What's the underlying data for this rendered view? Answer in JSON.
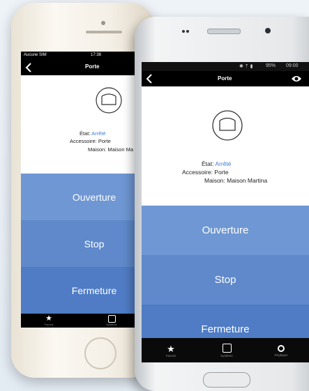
{
  "colors": {
    "link": "#3b7dd8",
    "btn_top": "#6f97d3",
    "btn_mid": "#5f89cb",
    "btn_bot": "#4f7cc4"
  },
  "iphone": {
    "status": {
      "carrier": "Aucune SIM",
      "time": "17:38"
    },
    "nav_title": "Porte",
    "info": {
      "etat_label": "État:",
      "etat_value": "Arrêté",
      "accessoire": "Accessoire: Porte",
      "maison": "Maison: Maison Ma"
    },
    "buttons": [
      "Ouverture",
      "Stop",
      "Fermeture"
    ],
    "tabs": [
      {
        "icon": "star-icon",
        "label": "Favoris"
      },
      {
        "icon": "house-icon",
        "label": "Système"
      }
    ]
  },
  "android": {
    "status": {
      "battery": "95%",
      "time": "09:00"
    },
    "nav_title": "Porte",
    "info": {
      "etat_label": "État:",
      "etat_value": "Arrêté",
      "accessoire": "Accessoire: Porte",
      "maison": "Maison: Maison Martina"
    },
    "buttons": [
      "Ouverture",
      "Stop",
      "Fermeture"
    ],
    "tabs": [
      {
        "icon": "star-icon",
        "label": "Favoris"
      },
      {
        "icon": "house-icon",
        "label": "Système"
      },
      {
        "icon": "gear-icon",
        "label": "Réglages"
      }
    ]
  }
}
